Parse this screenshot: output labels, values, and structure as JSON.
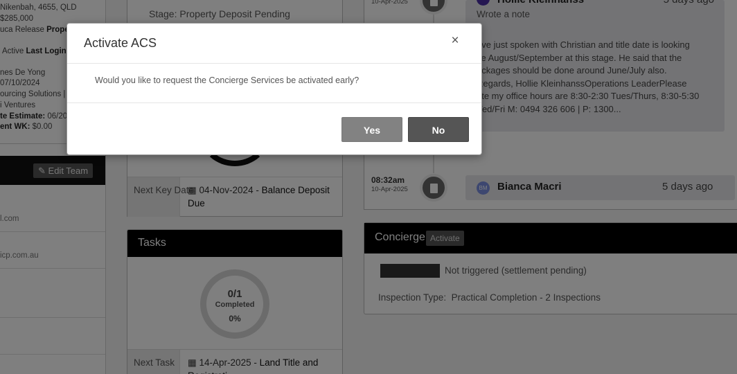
{
  "property": {
    "address": "Nikenbah, 4655, QLD",
    "price": "$285,000",
    "release_label": "uca Release",
    "release_value": "Proper",
    "status_prefix": "Active",
    "last_login_label": "Last Login",
    "contact_name": "nes De Yong",
    "date": "07/10/2024",
    "company": "ourcing Solutions  |",
    "ventures": "i Ventures",
    "estimate_label": "te Estimate:",
    "estimate_value": "06/20",
    "wk_label": "ent WK:",
    "wk_value": "$0.00"
  },
  "team": {
    "edit_label": "Edit Team",
    "email_1": "l.com",
    "email_2": "icp.com.au"
  },
  "stage": {
    "text": "Stage: Property Deposit Pending",
    "key_label": "Next Key Date",
    "key_date": "04-Nov-2024",
    "key_desc": "Balance Deposit Due"
  },
  "tasks": {
    "title": "Tasks",
    "count": "0/1",
    "completed_label": "Completed",
    "percent": "0%",
    "next_label": "Next Task",
    "next_date": "14-Apr-2025",
    "next_desc": "Land Title and Registrati"
  },
  "timeline": {
    "entry1": {
      "date": "10-Apr-2025",
      "author": "Hollie Kleinhanss",
      "ago": "5 days ago",
      "sub": "Wrote a note",
      "lines": [
        "ave just spoken with Christian and title date is looking",
        "ke August/September at this stage. He said that the",
        "ackages should be done around June/July also.",
        "Regards, Hollie KleinhanssOperations LeaderPlease",
        "ote my office hours are 8:30-2:30 Tues/Thurs, 8:30-5:30",
        "Ved/Fri M: 0494 326 606 |  P: 1300..."
      ]
    },
    "entry2": {
      "time": "08:32am",
      "date": "10-Apr-2025",
      "avatar": "BM",
      "author": "Bianca Macri",
      "ago": "5 days ago"
    }
  },
  "concierge": {
    "title": "Concierge",
    "activate_label": "Activate",
    "status": "Not triggered (settlement pending)",
    "inspection_label": "Inspection Type:",
    "inspection_value": "Practical Completion - 2 Inspections"
  },
  "modal": {
    "title": "Activate ACS",
    "close_symbol": "×",
    "message": "Would you like to request the Concierge Services be activated early?",
    "yes_label": "Yes",
    "no_label": "No"
  }
}
